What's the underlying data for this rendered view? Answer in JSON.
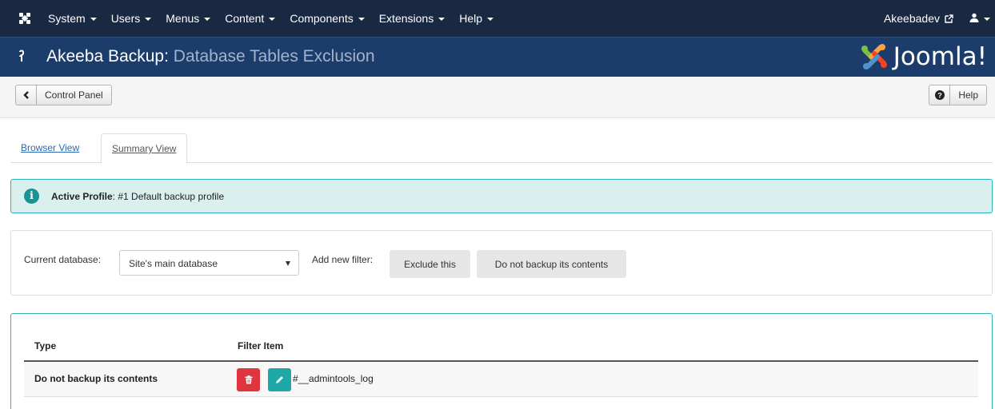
{
  "navbar": {
    "menu": [
      {
        "label": "System"
      },
      {
        "label": "Users"
      },
      {
        "label": "Menus"
      },
      {
        "label": "Content"
      },
      {
        "label": "Components"
      },
      {
        "label": "Extensions"
      },
      {
        "label": "Help"
      }
    ],
    "site_name": "Akeebadev",
    "icons": {
      "logo": "joomla-logo-icon",
      "external": "external-link-icon",
      "user": "user-icon"
    }
  },
  "header": {
    "title_main": "Akeeba Backup:",
    "title_sub": "Database Tables Exclusion",
    "brand": "Joomla!",
    "colors": {
      "bar": "#1c3d6b",
      "nav": "#1a2942"
    }
  },
  "toolbar": {
    "back_label": "Control Panel",
    "help_label": "Help"
  },
  "tabs": [
    {
      "label": "Browser View",
      "active": false
    },
    {
      "label": "Summary View",
      "active": true
    }
  ],
  "alert": {
    "label": "Active Profile",
    "value": ": #1 Default backup profile",
    "color": "#2eb4b5"
  },
  "filters": {
    "db_label": "Current database:",
    "db_selected": "Site's main database",
    "add_label": "Add new filter:",
    "exclude_label": "Exclude this",
    "nobackup_label": "Do not backup its contents"
  },
  "table": {
    "headers": [
      "Type",
      "Filter Item"
    ],
    "rows": [
      {
        "type": "Do not backup its contents",
        "item": "#__admintools_log"
      }
    ],
    "colors": {
      "delete": "#e0353f",
      "edit": "#1fa8a8"
    }
  }
}
